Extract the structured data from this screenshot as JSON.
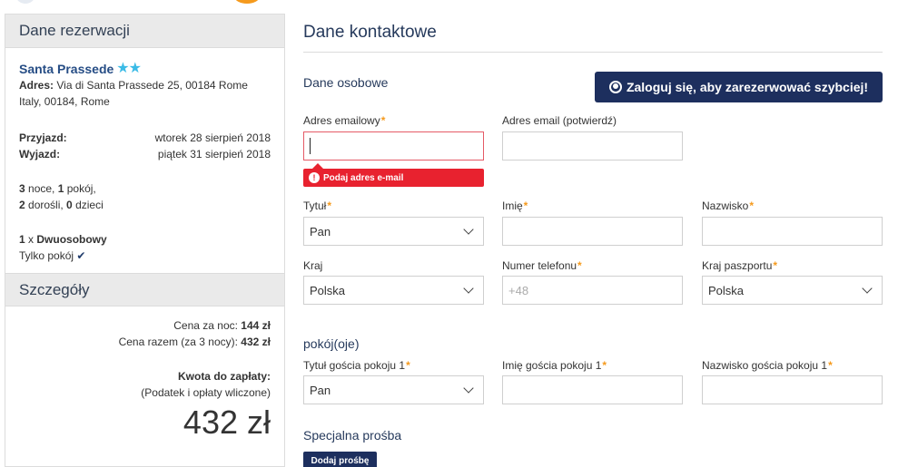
{
  "booking": {
    "header": "Dane rezerwacji",
    "hotel_name": "Santa Prassede",
    "stars": "★★",
    "address_label": "Adres:",
    "address_line1": "Via di Santa Prassede 25, 00184 Rome",
    "address_line2": "Italy, 00184, Rome",
    "checkin_label": "Przyjazd:",
    "checkin_value": "wtorek 28 sierpień 2018",
    "checkout_label": "Wyjazd:",
    "checkout_value": "piątek 31 sierpień 2018",
    "nights_num": "3",
    "nights_text": " noce, ",
    "rooms_num": "1",
    "rooms_text": " pokój,",
    "adults_num": "2",
    "adults_text": " dorośli, ",
    "children_num": "0",
    "children_text": " dzieci",
    "room_qty": "1",
    "room_x": " x ",
    "room_type": "Dwuosobowy",
    "room_only": "Tylko pokój",
    "check_icon": "checkmark-icon"
  },
  "details": {
    "header": "Szczegóły",
    "price_per_night_label": "Cena za noc: ",
    "price_per_night": "144 zł",
    "price_total_label": "Cena razem (za 3 nocy): ",
    "price_total": "432 zł",
    "amount_due_label": "Kwota do zapłaty:",
    "tax_note": "(Podatek i opłaty wliczone)",
    "big_price": "432 zł"
  },
  "contact": {
    "title": "Dane kontaktowe",
    "personal_heading": "Dane osobowe",
    "login_button": "Zaloguj się, aby zarezerwować szybciej!",
    "required_mark": "*",
    "email_label": "Adres emailowy",
    "email_value": "",
    "email_error": "Podaj adres e-mail",
    "email_confirm_label": "Adres email (potwierdź)",
    "title_label": "Tytuł",
    "title_value": "Pan",
    "first_name_label": "Imię",
    "last_name_label": "Nazwisko",
    "country_label": "Kraj",
    "country_value": "Polska",
    "phone_label": "Numer telefonu",
    "phone_placeholder": "+48",
    "passport_country_label": "Kraj paszportu",
    "passport_country_value": "Polska"
  },
  "rooms": {
    "heading": "pokój(oje)",
    "guest_title_label": "Tytuł gościa pokoju 1",
    "guest_title_value": "Pan",
    "guest_first_name_label": "Imię gościa pokoju 1",
    "guest_last_name_label": "Nazwisko gościa pokoju 1"
  },
  "special": {
    "heading": "Specjalna prośba",
    "add_button": "Dodaj prośbę"
  },
  "colors": {
    "primary": "#1d2f5e",
    "accent": "#f59a1d",
    "error": "#e8222f",
    "star": "#3bbbe6"
  }
}
